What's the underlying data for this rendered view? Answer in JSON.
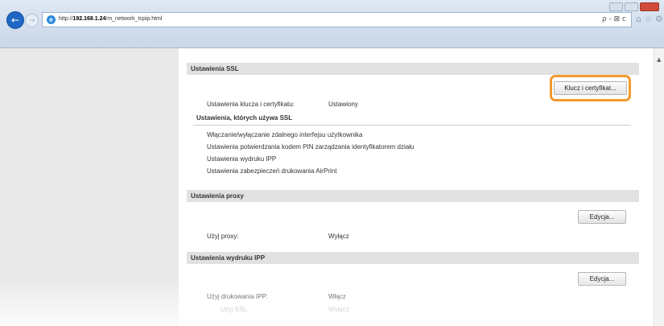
{
  "browser": {
    "url_prefix": "http://",
    "url_host": "192.168.1.24",
    "url_path": "/m_network_tcpip.html",
    "address_tools": "ρ - ⊠ c",
    "fav_icons": "⌂ ☆ ⚙"
  },
  "ssl": {
    "header": "Ustawienia SSL",
    "button": "Klucz i certyfikat...",
    "key_label": "Ustawienia klucza i certyfikatu:",
    "key_value": "Ustawiony",
    "uses_header": "Ustawienia, których używa SSL",
    "uses_items": [
      "Włączanie/wyłączanie zdalnego interfejsu użytkownika",
      "Ustawienia potwierdzania kodem PIN zarządzania identyfikatorem działu",
      "Ustawienia wydruku IPP",
      "Ustawienia zabezpieczeń drukowania AirPrint"
    ]
  },
  "proxy": {
    "header": "Ustawienia proxy",
    "button": "Edycja...",
    "use_label": "Użyj proxy:",
    "use_value": "Wyłącz"
  },
  "ipp": {
    "header": "Ustawienia wydruku IPP",
    "button": "Edycja...",
    "use_label": "Użyj drukowania IPP:",
    "use_value": "Włącz",
    "ssl_label": "Użyj SSL:",
    "ssl_value": "Wyłącz"
  },
  "colors": {
    "highlight": "#f29a2e",
    "section_bg": "#e1e1e1"
  }
}
